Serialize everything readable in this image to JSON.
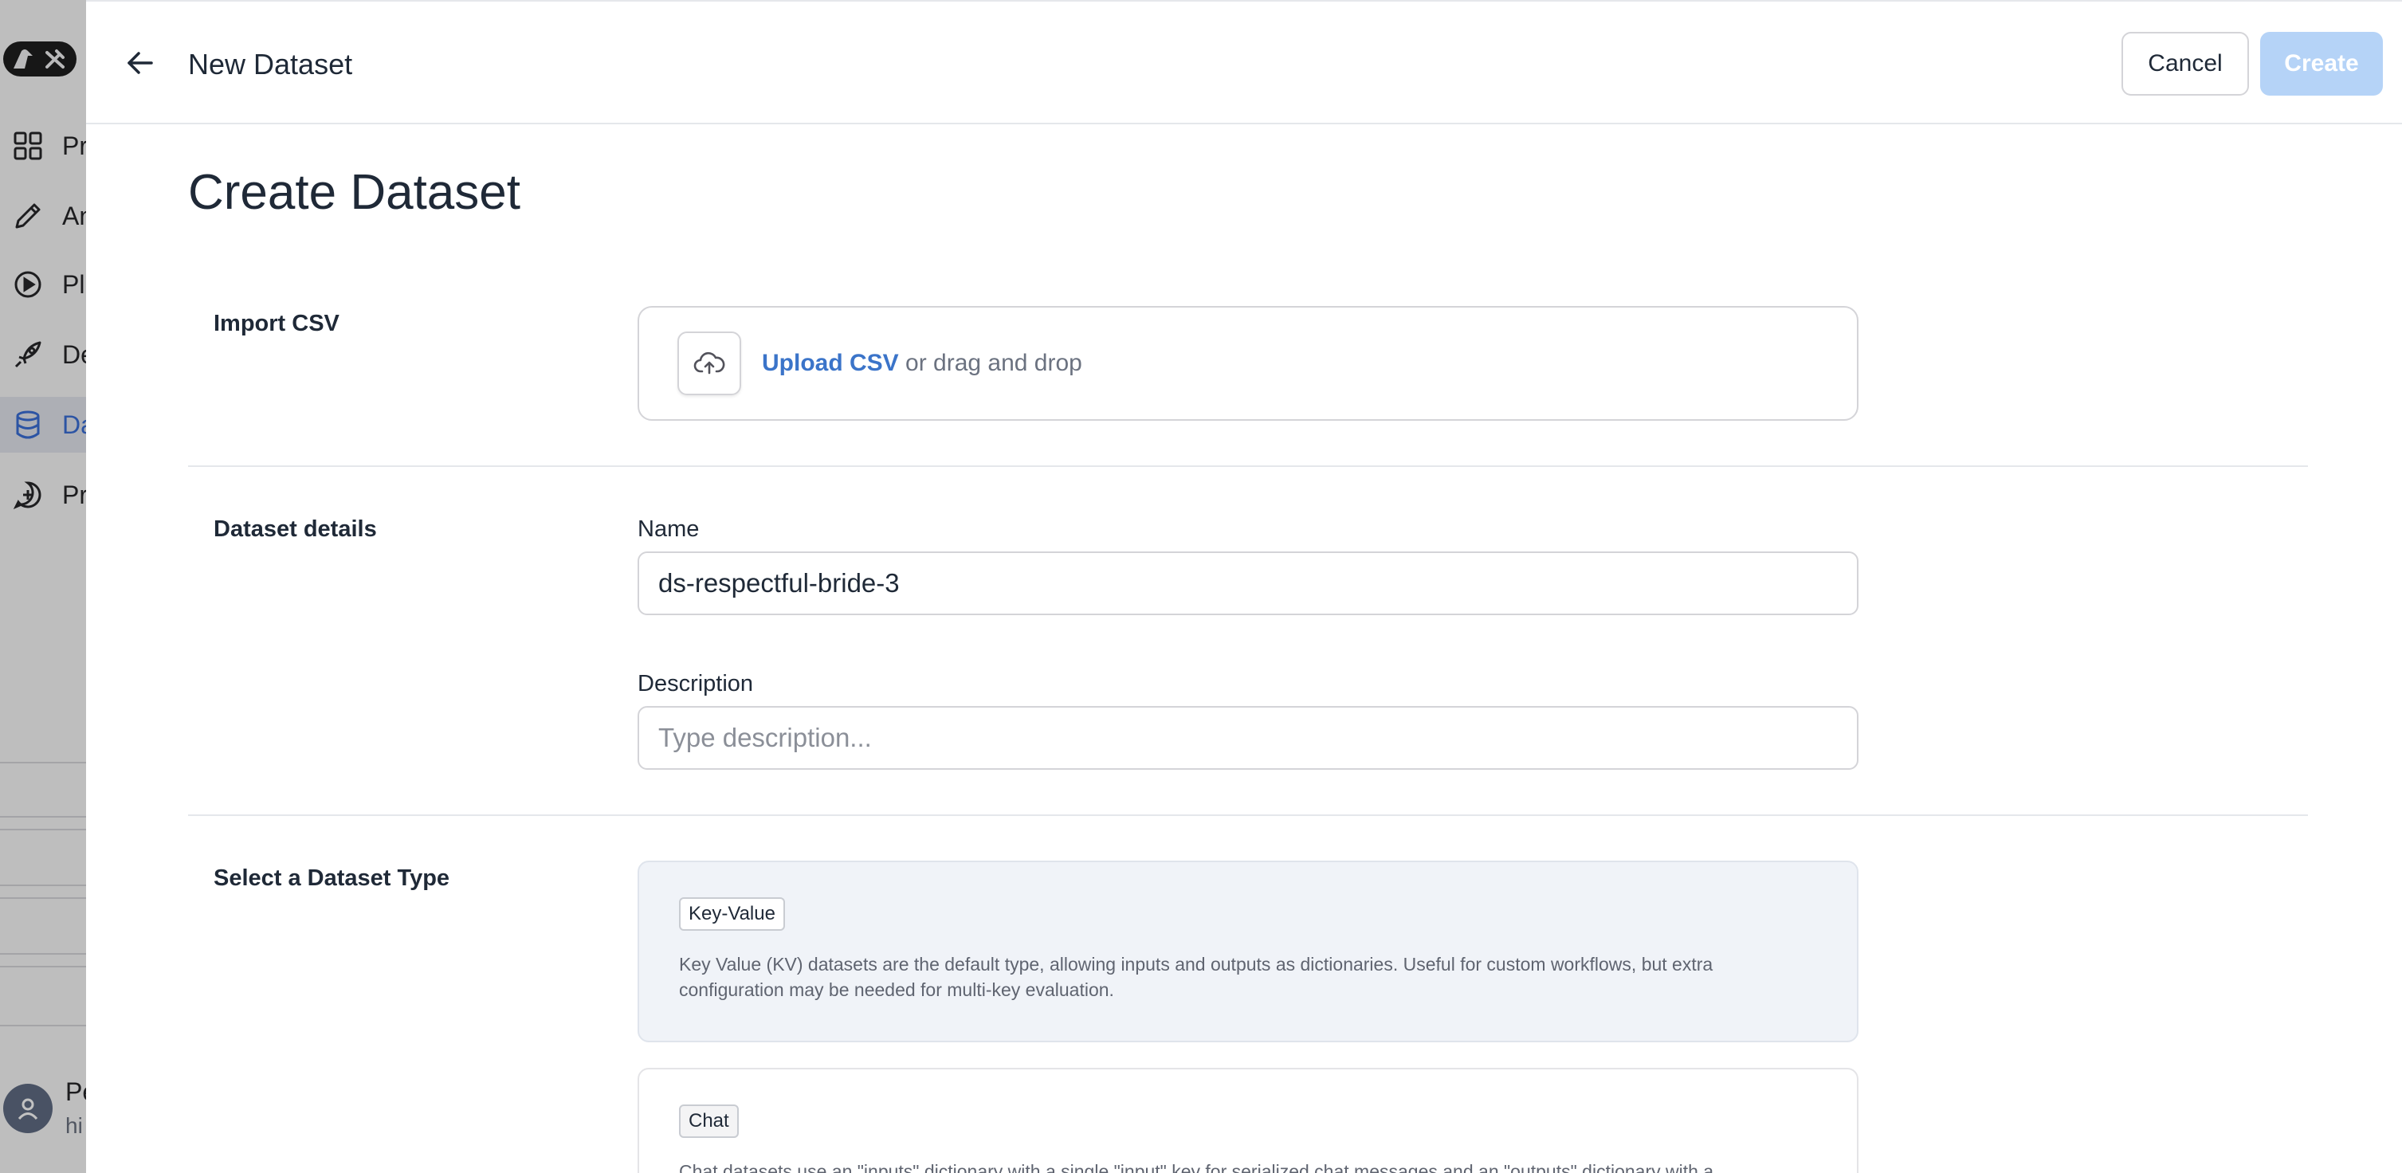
{
  "background": {
    "nav_items": [
      {
        "label": "Pr",
        "icon": "grid-icon"
      },
      {
        "label": "An",
        "icon": "pencil-icon"
      },
      {
        "label": "Pl",
        "icon": "play-circle-icon"
      },
      {
        "label": "De",
        "icon": "rocket-icon"
      },
      {
        "label": "Da",
        "icon": "database-icon",
        "active": true
      },
      {
        "label": "Pr",
        "icon": "chat-plus-icon"
      }
    ],
    "user": {
      "name": "Pe",
      "sub": "hi"
    }
  },
  "header": {
    "title": "New Dataset",
    "cancel_label": "Cancel",
    "create_label": "Create"
  },
  "page": {
    "title": "Create Dataset"
  },
  "import_csv": {
    "section_label": "Import CSV",
    "upload_link": "Upload CSV",
    "upload_suffix": " or drag and drop"
  },
  "details": {
    "section_label": "Dataset details",
    "name_label": "Name",
    "name_value": "ds-respectful-bride-3",
    "description_label": "Description",
    "description_placeholder": "Type description..."
  },
  "dataset_type": {
    "section_label": "Select a Dataset Type",
    "options": [
      {
        "badge": "Key-Value",
        "description": "Key Value (KV) datasets are the default type, allowing inputs and outputs as dictionaries. Useful for custom workflows, but extra configuration may be needed for multi-key evaluation.",
        "selected": true
      },
      {
        "badge": "Chat",
        "description": "Chat datasets use an \"inputs\" dictionary with a single \"input\" key for serialized chat messages and an \"outputs\" dictionary with a",
        "selected": false
      }
    ]
  },
  "colors": {
    "accent": "#3b74c9",
    "create_disabled": "#b5d3f7",
    "selected_card": "#f0f3f8"
  }
}
